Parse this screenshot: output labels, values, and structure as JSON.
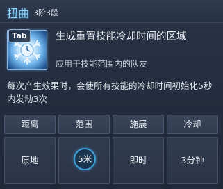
{
  "skill": {
    "name": "扭曲",
    "level": "3阶3段",
    "hotkey": "Tab",
    "icon": "snowflake-clock-icon",
    "description_title": "生成重置技能冷却时间的区域",
    "description_sub": "应用于技能范围内的队友",
    "effect": "每次产生效果时，会使所有技能的冷却时间初始化5秒内发动3次"
  },
  "stats": [
    {
      "label": "距离",
      "value": "原地"
    },
    {
      "label": "范围",
      "value": "5米"
    },
    {
      "label": "施展",
      "value": "即时"
    },
    {
      "label": "冷却",
      "value": "3分钟"
    }
  ],
  "colors": {
    "skill_name": "#8fd8ff",
    "panel_bg": "#242e40",
    "range_ring": "#3fa0d8"
  }
}
